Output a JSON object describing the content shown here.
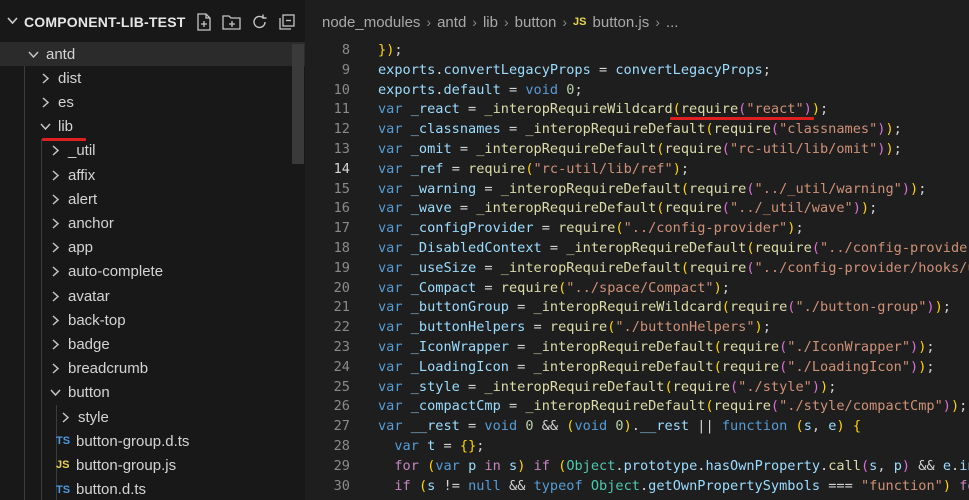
{
  "explorer": {
    "title": "COMPONENT-LIB-TEST",
    "icons": [
      "new-file-icon",
      "new-folder-icon",
      "refresh-icon",
      "collapse-all-icon"
    ],
    "tree": [
      {
        "label": "antd",
        "type": "folder",
        "open": true,
        "depth": 1,
        "selected": true
      },
      {
        "label": "dist",
        "type": "folder",
        "open": false,
        "depth": 2
      },
      {
        "label": "es",
        "type": "folder",
        "open": false,
        "depth": 2
      },
      {
        "label": "lib",
        "type": "folder",
        "open": true,
        "depth": 2,
        "underline": true
      },
      {
        "label": "_util",
        "type": "folder",
        "open": false,
        "depth": 3
      },
      {
        "label": "affix",
        "type": "folder",
        "open": false,
        "depth": 3
      },
      {
        "label": "alert",
        "type": "folder",
        "open": false,
        "depth": 3
      },
      {
        "label": "anchor",
        "type": "folder",
        "open": false,
        "depth": 3
      },
      {
        "label": "app",
        "type": "folder",
        "open": false,
        "depth": 3
      },
      {
        "label": "auto-complete",
        "type": "folder",
        "open": false,
        "depth": 3
      },
      {
        "label": "avatar",
        "type": "folder",
        "open": false,
        "depth": 3
      },
      {
        "label": "back-top",
        "type": "folder",
        "open": false,
        "depth": 3
      },
      {
        "label": "badge",
        "type": "folder",
        "open": false,
        "depth": 3
      },
      {
        "label": "breadcrumb",
        "type": "folder",
        "open": false,
        "depth": 3
      },
      {
        "label": "button",
        "type": "folder",
        "open": true,
        "depth": 3
      },
      {
        "label": "style",
        "type": "folder",
        "open": false,
        "depth": 4
      },
      {
        "label": "button-group.d.ts",
        "type": "ts",
        "depth": 4
      },
      {
        "label": "button-group.js",
        "type": "js",
        "depth": 4
      },
      {
        "label": "button.d.ts",
        "type": "ts",
        "depth": 4
      }
    ]
  },
  "breadcrumb": {
    "items": [
      "node_modules",
      "antd",
      "lib",
      "button"
    ],
    "file_badge": "JS",
    "file": "button.js",
    "more": "..."
  },
  "editor": {
    "current_line": 14,
    "lines": [
      {
        "n": 8,
        "t": "});"
      },
      {
        "n": 9,
        "t": "exports.convertLegacyProps = convertLegacyProps;"
      },
      {
        "n": 10,
        "t": "exports.default = void 0;"
      },
      {
        "n": 11,
        "t": "var _react = _interopRequireWildcard(require(\"react\"));"
      },
      {
        "n": 12,
        "t": "var _classnames = _interopRequireDefault(require(\"classnames\"));"
      },
      {
        "n": 13,
        "t": "var _omit = _interopRequireDefault(require(\"rc-util/lib/omit\"));"
      },
      {
        "n": 14,
        "t": "var _ref = require(\"rc-util/lib/ref\");"
      },
      {
        "n": 15,
        "t": "var _warning = _interopRequireDefault(require(\"../_util/warning\"));"
      },
      {
        "n": 16,
        "t": "var _wave = _interopRequireDefault(require(\"../_util/wave\"));"
      },
      {
        "n": 17,
        "t": "var _configProvider = require(\"../config-provider\");"
      },
      {
        "n": 18,
        "t": "var _DisabledContext = _interopRequireDefault(require(\"../config-provider/D"
      },
      {
        "n": 19,
        "t": "var _useSize = _interopRequireDefault(require(\"../config-provider/hooks/use"
      },
      {
        "n": 20,
        "t": "var _Compact = require(\"../space/Compact\");"
      },
      {
        "n": 21,
        "t": "var _buttonGroup = _interopRequireWildcard(require(\"./button-group\"));"
      },
      {
        "n": 22,
        "t": "var _buttonHelpers = require(\"./buttonHelpers\");"
      },
      {
        "n": 23,
        "t": "var _IconWrapper = _interopRequireDefault(require(\"./IconWrapper\"));"
      },
      {
        "n": 24,
        "t": "var _LoadingIcon = _interopRequireDefault(require(\"./LoadingIcon\"));"
      },
      {
        "n": 25,
        "t": "var _style = _interopRequireDefault(require(\"./style\"));"
      },
      {
        "n": 26,
        "t": "var _compactCmp = _interopRequireDefault(require(\"./style/compactCmp\"));"
      },
      {
        "n": 27,
        "t": "var __rest = void 0 && (void 0).__rest || function (s, e) {"
      },
      {
        "n": 28,
        "t": "  var t = {};"
      },
      {
        "n": 29,
        "t": "  for (var p in s) if (Object.prototype.hasOwnProperty.call(s, p) && e.inde"
      },
      {
        "n": 30,
        "t": "  if (s != null && typeof Object.getOwnPropertySymbols === \"function\") for"
      }
    ]
  },
  "colors": {
    "annotation": "#e02020",
    "keyword": "#569cd6",
    "string": "#ce9178",
    "function": "#dcdcaa"
  }
}
